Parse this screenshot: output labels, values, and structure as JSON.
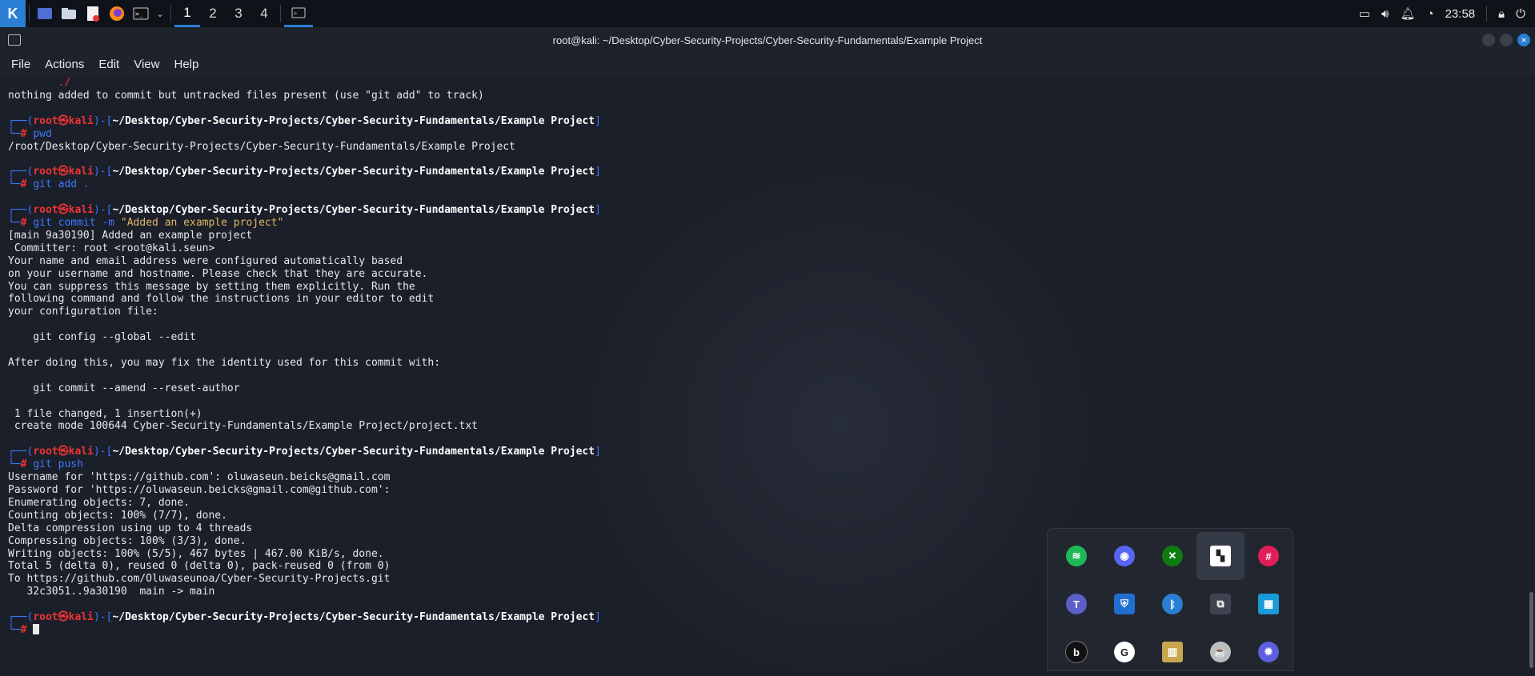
{
  "panel": {
    "workspaces": [
      "1",
      "2",
      "3",
      "4"
    ],
    "active_workspace": "1",
    "clock": "23:58",
    "launchers": [
      "kali-menu-icon",
      "desktop-icon",
      "files-icon",
      "text-editor-icon",
      "firefox-icon",
      "terminal-icon"
    ],
    "tray_icons": [
      "display-icon",
      "volume-icon",
      "notification-bell-icon",
      "clock-icon",
      "lock-icon",
      "power-icon"
    ]
  },
  "window": {
    "title": "root@kali: ~/Desktop/Cyber-Security-Projects/Cyber-Security-Fundamentals/Example Project"
  },
  "menu": [
    "File",
    "Actions",
    "Edit",
    "View",
    "Help"
  ],
  "terminal": {
    "cwd": "~/Desktop/Cyber-Security-Projects/Cyber-Security-Fundamentals/Example Project",
    "user": "root",
    "host": "kali",
    "top_fragment": "./",
    "line_untracked": "nothing added to commit but untracked files present (use \"git add\" to track)",
    "cmd_pwd": "pwd",
    "out_pwd": "/root/Desktop/Cyber-Security-Projects/Cyber-Security-Fundamentals/Example Project",
    "cmd_add": "git add .",
    "cmd_commit": "git commit",
    "commit_flag": "-m",
    "commit_msg": "\"Added an example project\"",
    "commit_output": [
      "[main 9a30190] Added an example project",
      " Committer: root <root@kali.seun>",
      "Your name and email address were configured automatically based",
      "on your username and hostname. Please check that they are accurate.",
      "You can suppress this message by setting them explicitly. Run the",
      "following command and follow the instructions in your editor to edit",
      "your configuration file:",
      "",
      "    git config --global --edit",
      "",
      "After doing this, you may fix the identity used for this commit with:",
      "",
      "    git commit --amend --reset-author",
      "",
      " 1 file changed, 1 insertion(+)",
      " create mode 100644 Cyber-Security-Fundamentals/Example Project/project.txt"
    ],
    "cmd_push": "git push",
    "push_output": [
      "Username for 'https://github.com': oluwaseun.beicks@gmail.com",
      "Password for 'https://oluwaseun.beicks@gmail.com@github.com':",
      "Enumerating objects: 7, done.",
      "Counting objects: 100% (7/7), done.",
      "Delta compression using up to 4 threads",
      "Compressing objects: 100% (3/3), done.",
      "Writing objects: 100% (5/5), 467 bytes | 467.00 KiB/s, done.",
      "Total 5 (delta 0), reused 0 (delta 0), pack-reused 0 (from 0)",
      "To https://github.com/Oluwaseunoa/Cyber-Security-Projects.git",
      "   32c3051..9a30190  main -> main"
    ]
  },
  "tray_popup": {
    "items": [
      {
        "name": "spotify-icon",
        "color": "#1db954",
        "glyph": "≋"
      },
      {
        "name": "discord-icon",
        "color": "#5865f2",
        "glyph": "◉"
      },
      {
        "name": "xbox-icon",
        "color": "#107c10",
        "glyph": "✕"
      },
      {
        "name": "bookmark-app-icon",
        "color": "#ffffff",
        "glyph": "▚"
      },
      {
        "name": "slack-icon",
        "color": "#e01e5a",
        "glyph": "#"
      },
      {
        "name": "teams-icon",
        "color": "#5b5fc7",
        "glyph": "T"
      },
      {
        "name": "defender-warning-icon",
        "color": "#1f6fd1",
        "glyph": "⛨"
      },
      {
        "name": "bluetooth-icon",
        "color": "#2a7fd4",
        "glyph": "ᛒ"
      },
      {
        "name": "media-copy-icon",
        "color": "#3d4350",
        "glyph": "⧉"
      },
      {
        "name": "windows-app-icon",
        "color": "#1a9ad6",
        "glyph": "▦"
      },
      {
        "name": "beats-icon",
        "color": "#111111",
        "glyph": "b"
      },
      {
        "name": "grammarly-icon",
        "color": "#ffffff",
        "glyph": "G"
      },
      {
        "name": "color-bars-icon",
        "color": "#c8a64b",
        "glyph": "▥"
      },
      {
        "name": "coffee-cup-icon",
        "color": "#bdbdbd",
        "glyph": "☕"
      },
      {
        "name": "settings-cog-icon",
        "color": "#5b5fe0",
        "glyph": "✹"
      }
    ]
  }
}
